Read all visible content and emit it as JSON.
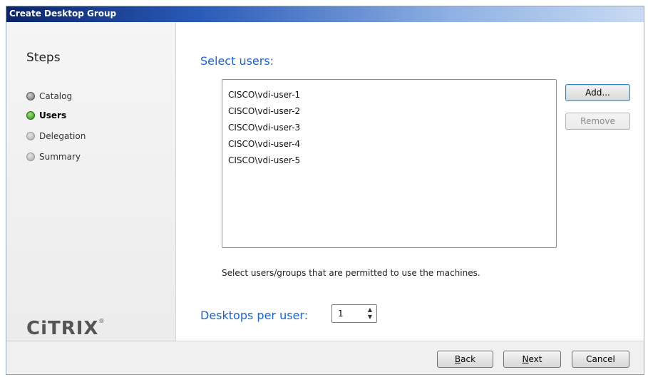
{
  "window": {
    "title": "Create Desktop Group"
  },
  "sidebar": {
    "title": "Steps",
    "steps": [
      {
        "label": "Catalog",
        "state": "done"
      },
      {
        "label": "Users",
        "state": "active"
      },
      {
        "label": "Delegation",
        "state": "pending"
      },
      {
        "label": "Summary",
        "state": "pending"
      }
    ],
    "logo_text": "CiTRIX",
    "logo_mark": "®"
  },
  "main": {
    "select_users_heading": "Select users:",
    "users": [
      "CISCO\\vdi-user-1",
      "CISCO\\vdi-user-2",
      "CISCO\\vdi-user-3",
      "CISCO\\vdi-user-4",
      "CISCO\\vdi-user-5"
    ],
    "add_button": "Add...",
    "remove_button": "Remove",
    "hint": "Select users/groups that are permitted to use the machines.",
    "desktops_per_user_label": "Desktops per user:",
    "desktops_per_user_value": "1"
  },
  "footer": {
    "back_accel": "B",
    "back_rest": "ack",
    "next_accel": "N",
    "next_rest": "ext",
    "cancel": "Cancel"
  },
  "colors": {
    "accent_heading": "#1c64c8",
    "active_step": "#2c8a14",
    "titlebar": "#0a246a"
  },
  "icons": {
    "step_done": "gray-bullet-icon",
    "step_active": "green-bullet-icon",
    "step_pending": "light-gray-bullet-icon",
    "spinner": "up-down-arrows-icon"
  }
}
